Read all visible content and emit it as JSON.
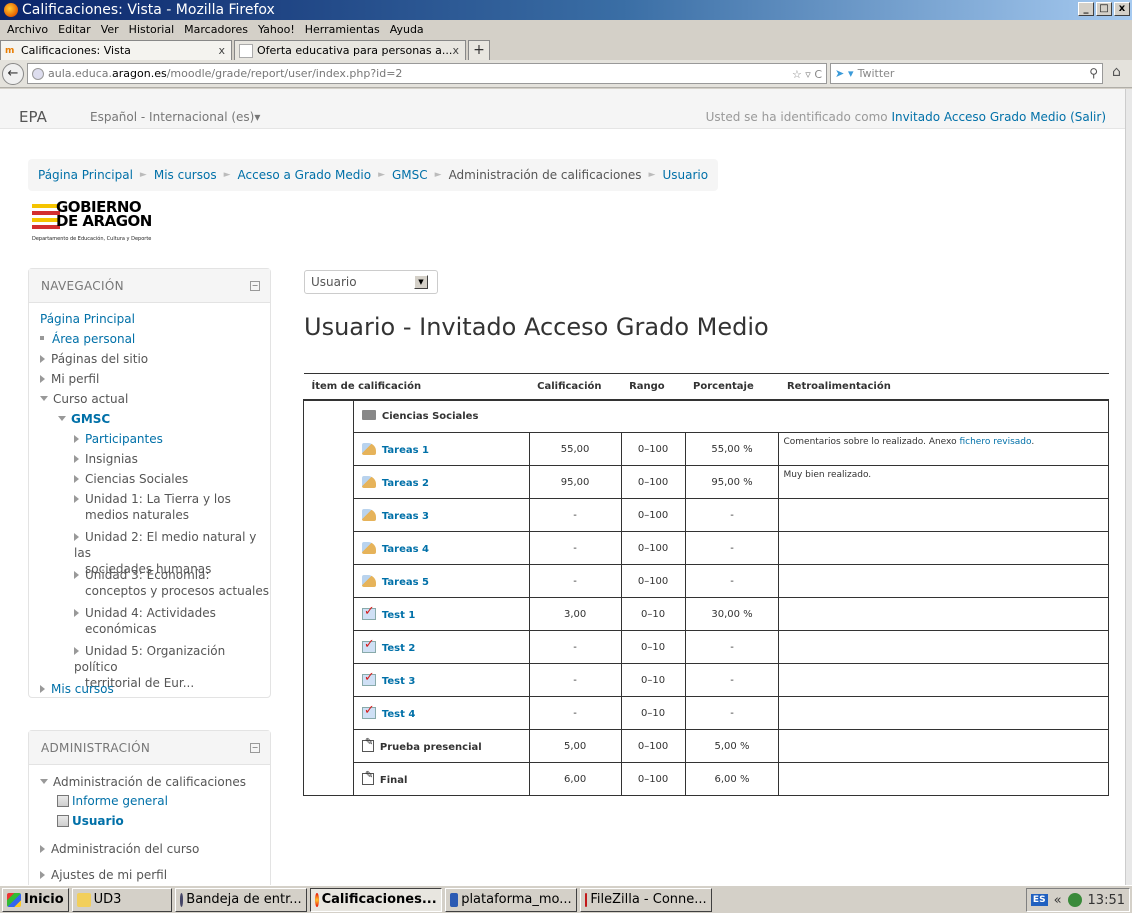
{
  "window": {
    "title": "Calificaciones: Vista - Mozilla Firefox",
    "buttons": [
      "_",
      "□",
      "x"
    ]
  },
  "menu": [
    "Archivo",
    "Editar",
    "Ver",
    "Historial",
    "Marcadores",
    "Yahoo!",
    "Herramientas",
    "Ayuda"
  ],
  "tabs": [
    {
      "label": "Calificaciones: Vista",
      "close": "x"
    },
    {
      "label": "Oferta educativa para personas a...",
      "close": "x"
    }
  ],
  "new_tab": "+",
  "address": {
    "prefix": "aula.educa.",
    "domain": "aragon.es",
    "path": "/moodle/grade/report/user/index.php?id=2",
    "icons": "☆ ▿ C",
    "search_placeholder": "Twitter",
    "search_engine": "➤ ▾"
  },
  "header": {
    "brand": "EPA",
    "language": "Español - Internacional (es)▾",
    "login_prefix": "Usted se ha identificado como ",
    "login_user": "Invitado Acceso Grado Medio",
    "login_logout": "(Salir)"
  },
  "breadcrumb": [
    "Página Principal",
    "Mis cursos",
    "Acceso a Grado Medio",
    "GMSC",
    "Administración de calificaciones",
    "Usuario"
  ],
  "logo": {
    "line1": "GOBIERNO",
    "line2": "DE ARAGON",
    "line3": "Departamento de Educación, Cultura y Deporte"
  },
  "nav_block": {
    "title": "NAVEGACIÓN",
    "collapse": "−",
    "home": "Página Principal",
    "area_personal": "Área personal",
    "paginas_sitio": "Páginas del sitio",
    "mi_perfil": "Mi perfil",
    "curso_actual": "Curso actual",
    "gmsc": "GMSC",
    "participantes": "Participantes",
    "insignias": "Insignias",
    "ciencias_sociales": "Ciencias Sociales",
    "unidad1": [
      "Unidad 1: La Tierra y los",
      "medios naturales"
    ],
    "unidad2": [
      "Unidad 2: El medio natural y las",
      "sociedades humanas"
    ],
    "unidad3": [
      "Unidad 3: Economía:",
      "conceptos y procesos actuales"
    ],
    "unidad4": [
      "Unidad 4: Actividades",
      "económicas"
    ],
    "unidad5": [
      "Unidad 5: Organización político",
      "territorial de Eur..."
    ],
    "mis_cursos": "Mis cursos"
  },
  "admin_block": {
    "title": "ADMINISTRACIÓN",
    "collapse": "−",
    "admin_calif": "Administración de calificaciones",
    "informe_general": "Informe general",
    "usuario": "Usuario",
    "admin_curso": "Administración del curso",
    "ajustes_perfil": "Ajustes de mi perfil"
  },
  "selector": {
    "value": "Usuario",
    "arrow": "▼"
  },
  "page_title": "Usuario - Invitado Acceso Grado Medio",
  "grades": {
    "headers": [
      "Ítem de calificación",
      "Calificación",
      "Rango",
      "Porcentaje",
      "Retroalimentación"
    ],
    "category": "Ciencias Sociales",
    "rows": [
      {
        "name": "Tareas 1",
        "icon": "assignment-icon",
        "grade": "55,00",
        "range": "0–100",
        "pct": "55,00 %",
        "feedback": "Comentarios sobre lo realizado. Anexo ",
        "feedback_link": "fichero revisado",
        "feedback_end": "."
      },
      {
        "name": "Tareas 2",
        "icon": "assignment-icon",
        "grade": "95,00",
        "range": "0–100",
        "pct": "95,00 %",
        "feedback": "Muy bien realizado.",
        "feedback_link": "",
        "feedback_end": ""
      },
      {
        "name": "Tareas 3",
        "icon": "assignment-icon",
        "grade": "-",
        "range": "0–100",
        "pct": "-",
        "feedback": "",
        "feedback_link": "",
        "feedback_end": ""
      },
      {
        "name": "Tareas 4",
        "icon": "assignment-icon",
        "grade": "-",
        "range": "0–100",
        "pct": "-",
        "feedback": "",
        "feedback_link": "",
        "feedback_end": ""
      },
      {
        "name": "Tareas 5",
        "icon": "assignment-icon",
        "grade": "-",
        "range": "0–100",
        "pct": "-",
        "feedback": "",
        "feedback_link": "",
        "feedback_end": ""
      },
      {
        "name": "Test 1",
        "icon": "quiz-icon",
        "grade": "3,00",
        "range": "0–10",
        "pct": "30,00 %",
        "feedback": "",
        "feedback_link": "",
        "feedback_end": ""
      },
      {
        "name": "Test 2",
        "icon": "quiz-icon",
        "grade": "-",
        "range": "0–10",
        "pct": "-",
        "feedback": "",
        "feedback_link": "",
        "feedback_end": ""
      },
      {
        "name": "Test 3",
        "icon": "quiz-icon",
        "grade": "-",
        "range": "0–10",
        "pct": "-",
        "feedback": "",
        "feedback_link": "",
        "feedback_end": ""
      },
      {
        "name": "Test 4",
        "icon": "quiz-icon",
        "grade": "-",
        "range": "0–10",
        "pct": "-",
        "feedback": "",
        "feedback_link": "",
        "feedback_end": ""
      }
    ],
    "manual_rows": [
      {
        "name": "Prueba presencial",
        "grade": "5,00",
        "range": "0–100",
        "pct": "5,00 %"
      },
      {
        "name": "Final",
        "grade": "6,00",
        "range": "0–100",
        "pct": "6,00 %"
      }
    ]
  },
  "taskbar": {
    "start": "Inicio",
    "items": [
      "UD3",
      "Bandeja de entr...",
      "Calificaciones...",
      "plataforma_mo...",
      "FileZilla - Conne..."
    ],
    "lang": "ES",
    "tray_arrow": "«",
    "clock": "13:51"
  },
  "colors": {
    "link": "#0070a8",
    "titlebar": "#0a246a"
  }
}
